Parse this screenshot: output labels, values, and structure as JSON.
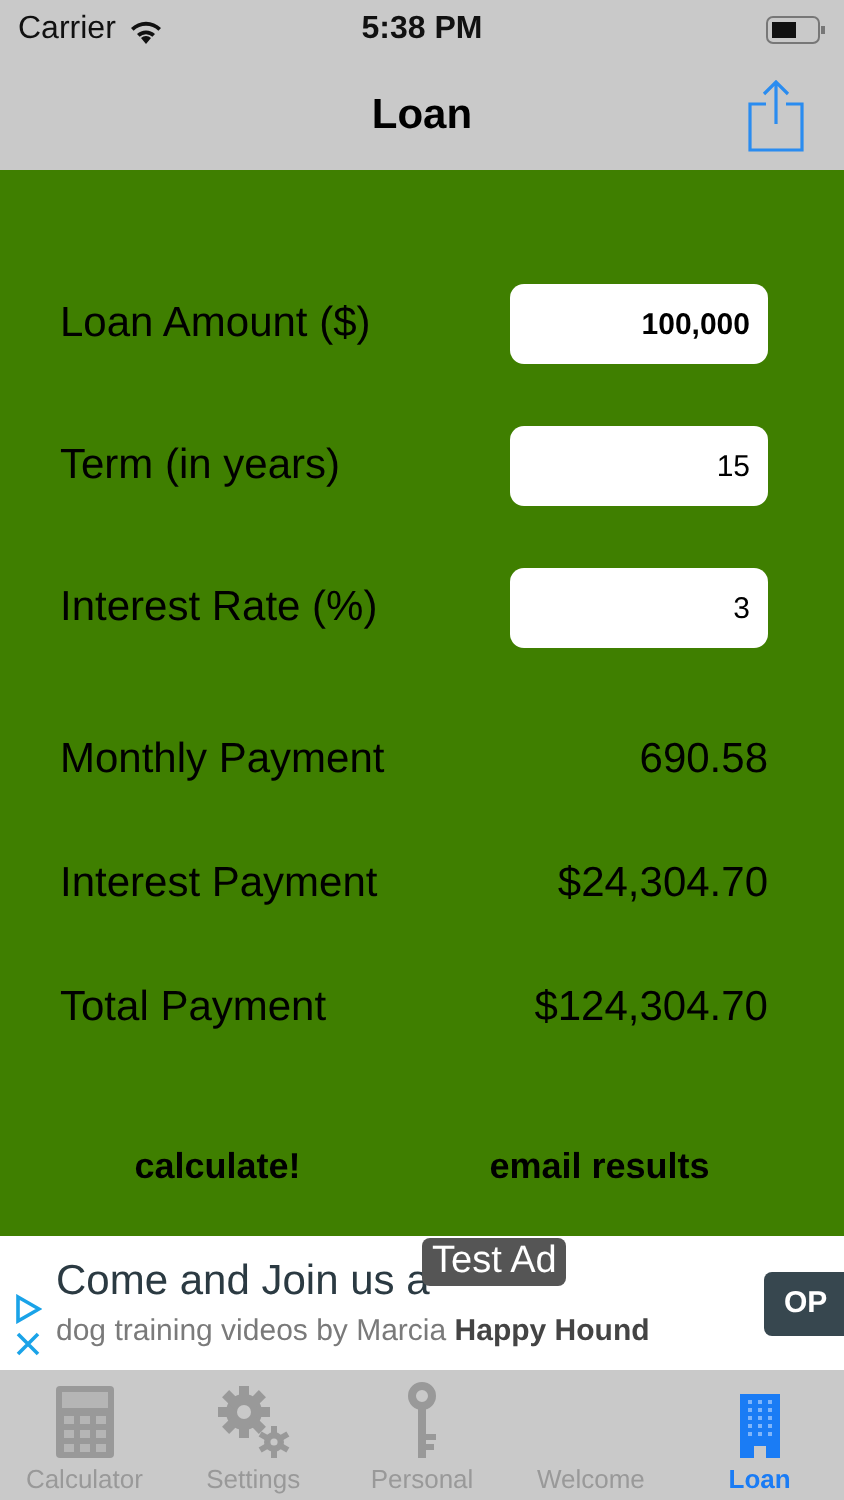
{
  "status_bar": {
    "carrier": "Carrier",
    "time": "5:38 PM"
  },
  "nav": {
    "title": "Loan"
  },
  "inputs": [
    {
      "label": "Loan Amount ($)",
      "value": "100,000",
      "emphasized": true
    },
    {
      "label": "Term (in years)",
      "value": "15",
      "emphasized": false
    },
    {
      "label": "Interest Rate (%)",
      "value": "3",
      "emphasized": false
    }
  ],
  "results": [
    {
      "label": "Monthly Payment",
      "value": "690.58"
    },
    {
      "label": "Interest Payment",
      "value": "$24,304.70"
    },
    {
      "label": "Total Payment",
      "value": "$124,304.70"
    }
  ],
  "actions": [
    "calculate!",
    "email results"
  ],
  "ad": {
    "badge": "Test Ad",
    "headline": "Come and Join us a",
    "text": "dog training videos by Marcia **Happy Hound**",
    "button": "OP"
  },
  "tabs": [
    {
      "label": "Calculator",
      "kind": "calculator",
      "selected": false
    },
    {
      "label": "Settings",
      "kind": "gears",
      "selected": false
    },
    {
      "label": "Personal",
      "kind": "key",
      "selected": false
    },
    {
      "label": "Welcome",
      "selected": false
    },
    {
      "label": "Loan",
      "kind": "building",
      "selected": true
    }
  ]
}
